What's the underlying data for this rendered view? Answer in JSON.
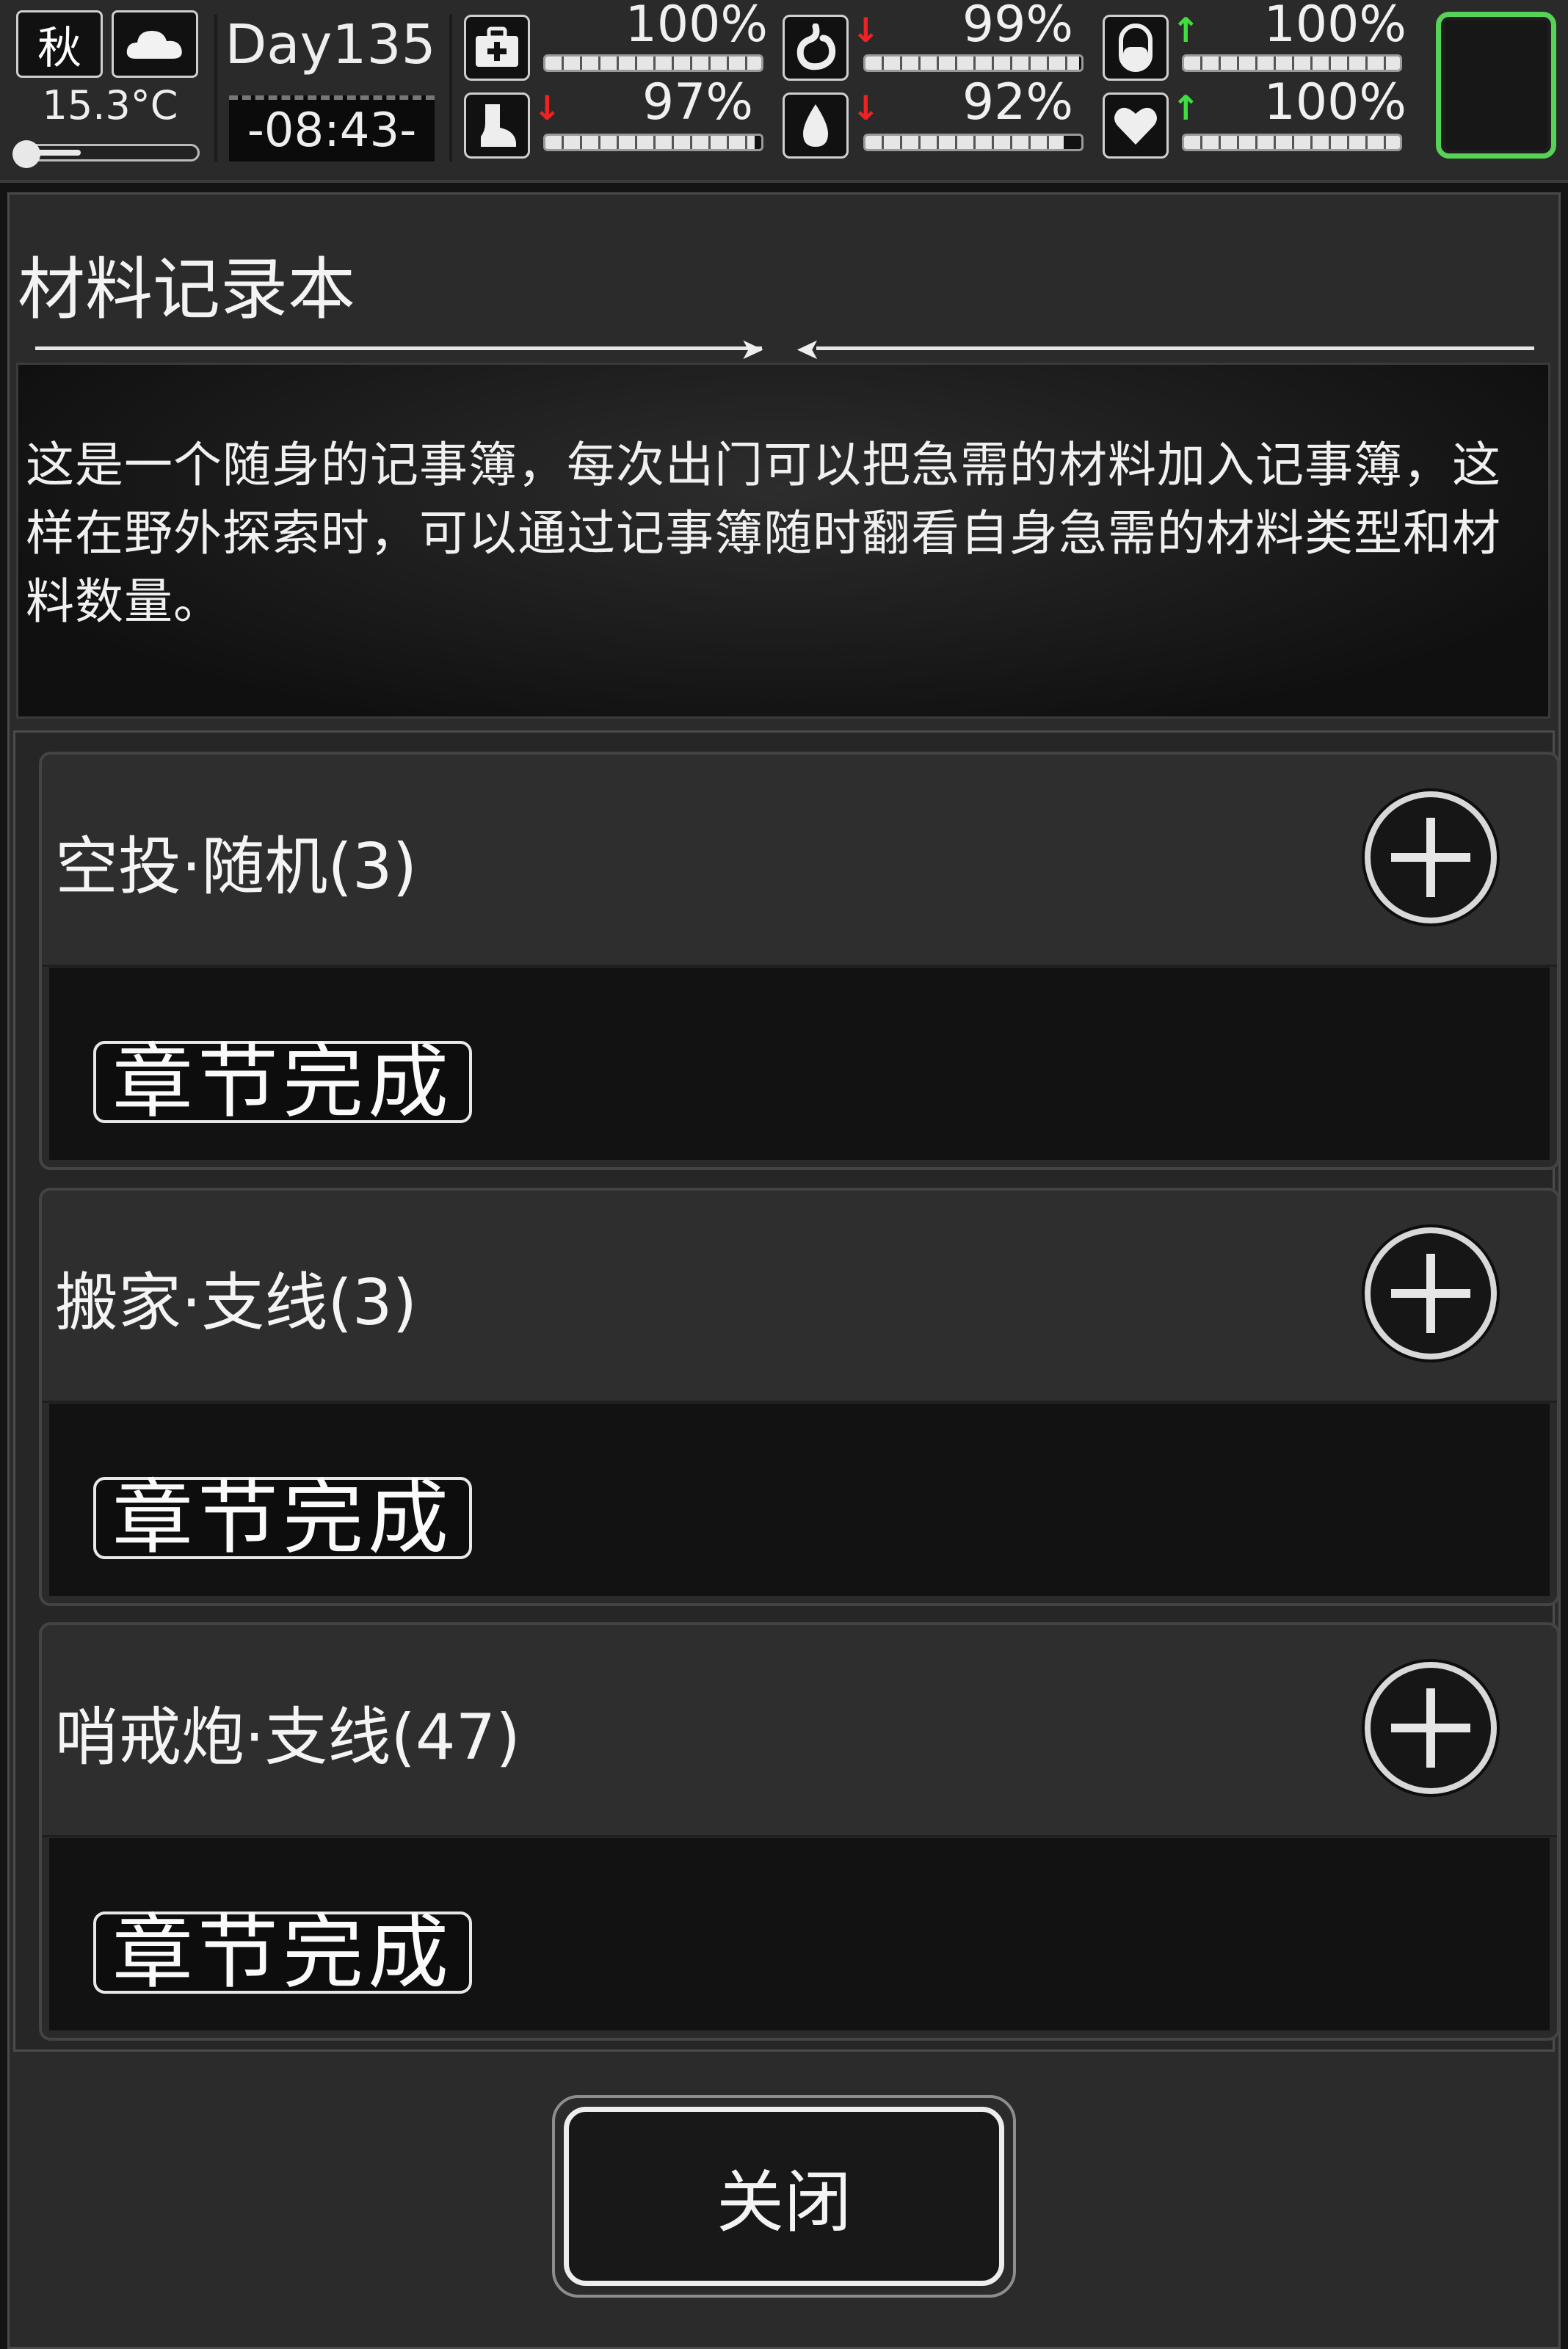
{
  "hud": {
    "season": "秋",
    "weather_icon": "cloud-icon",
    "temperature": "15.3°C",
    "temperature_level": 0.35,
    "day": "Day135",
    "clock": "-08:43-",
    "stats": [
      {
        "name": "health",
        "icon": "medkit-icon",
        "percent": "100%",
        "value": 100,
        "trend": "none"
      },
      {
        "name": "hunger",
        "icon": "stomach-icon",
        "percent": "99%",
        "value": 99,
        "trend": "down"
      },
      {
        "name": "stamina",
        "icon": "pill-icon",
        "percent": "100%",
        "value": 100,
        "trend": "up"
      },
      {
        "name": "leg",
        "icon": "boot-icon",
        "percent": "97%",
        "value": 97,
        "trend": "down"
      },
      {
        "name": "thirst",
        "icon": "water-drop-icon",
        "percent": "92%",
        "value": 92,
        "trend": "down"
      },
      {
        "name": "mood",
        "icon": "heart-icon",
        "percent": "100%",
        "value": 100,
        "trend": "up"
      }
    ],
    "slot_color": "#56d356"
  },
  "panel": {
    "title": "材料记录本",
    "description": "这是一个随身的记事簿，每次出门可以把急需的材料加入记事簿，这样在野外探索时，可以通过记事簿随时翻看自身急需的材料类型和材料数量。",
    "cards": [
      {
        "title": "空投·随机(3)",
        "status": "章节完成"
      },
      {
        "title": "搬家·支线(3)",
        "status": "章节完成"
      },
      {
        "title": "哨戒炮·支线(47)",
        "status": "章节完成"
      }
    ],
    "close_label": "关闭"
  }
}
